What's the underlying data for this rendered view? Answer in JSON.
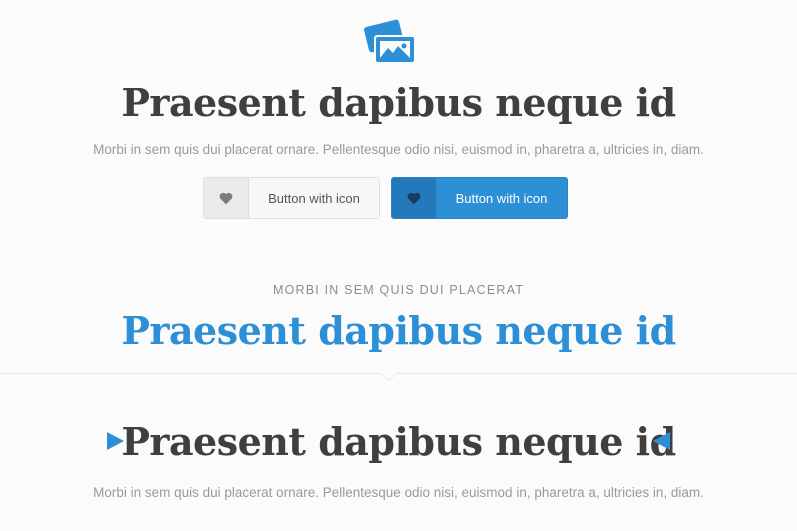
{
  "hero": {
    "icon": "images-icon",
    "title": "Praesent dapibus neque id",
    "text": "Morbi in sem quis dui placerat ornare. Pellentesque odio nisi, euismod in, pharetra a, ultricies in, diam."
  },
  "buttons": {
    "light_label": "Button with icon",
    "blue_label": "Button with icon",
    "icon": "heart-icon"
  },
  "section2": {
    "eyebrow": "MORBI IN SEM QUIS DUI PLACERAT",
    "title": "Praesent dapibus neque id"
  },
  "section3": {
    "title": "Praesent dapibus neque id",
    "text": "Morbi in sem quis dui placerat ornare. Pellentesque odio nisi, euismod in, pharetra a, ultricies in, diam."
  },
  "colors": {
    "accent": "#2d8fd6",
    "heading": "#3f3f3f",
    "muted": "#9a9a9a"
  }
}
